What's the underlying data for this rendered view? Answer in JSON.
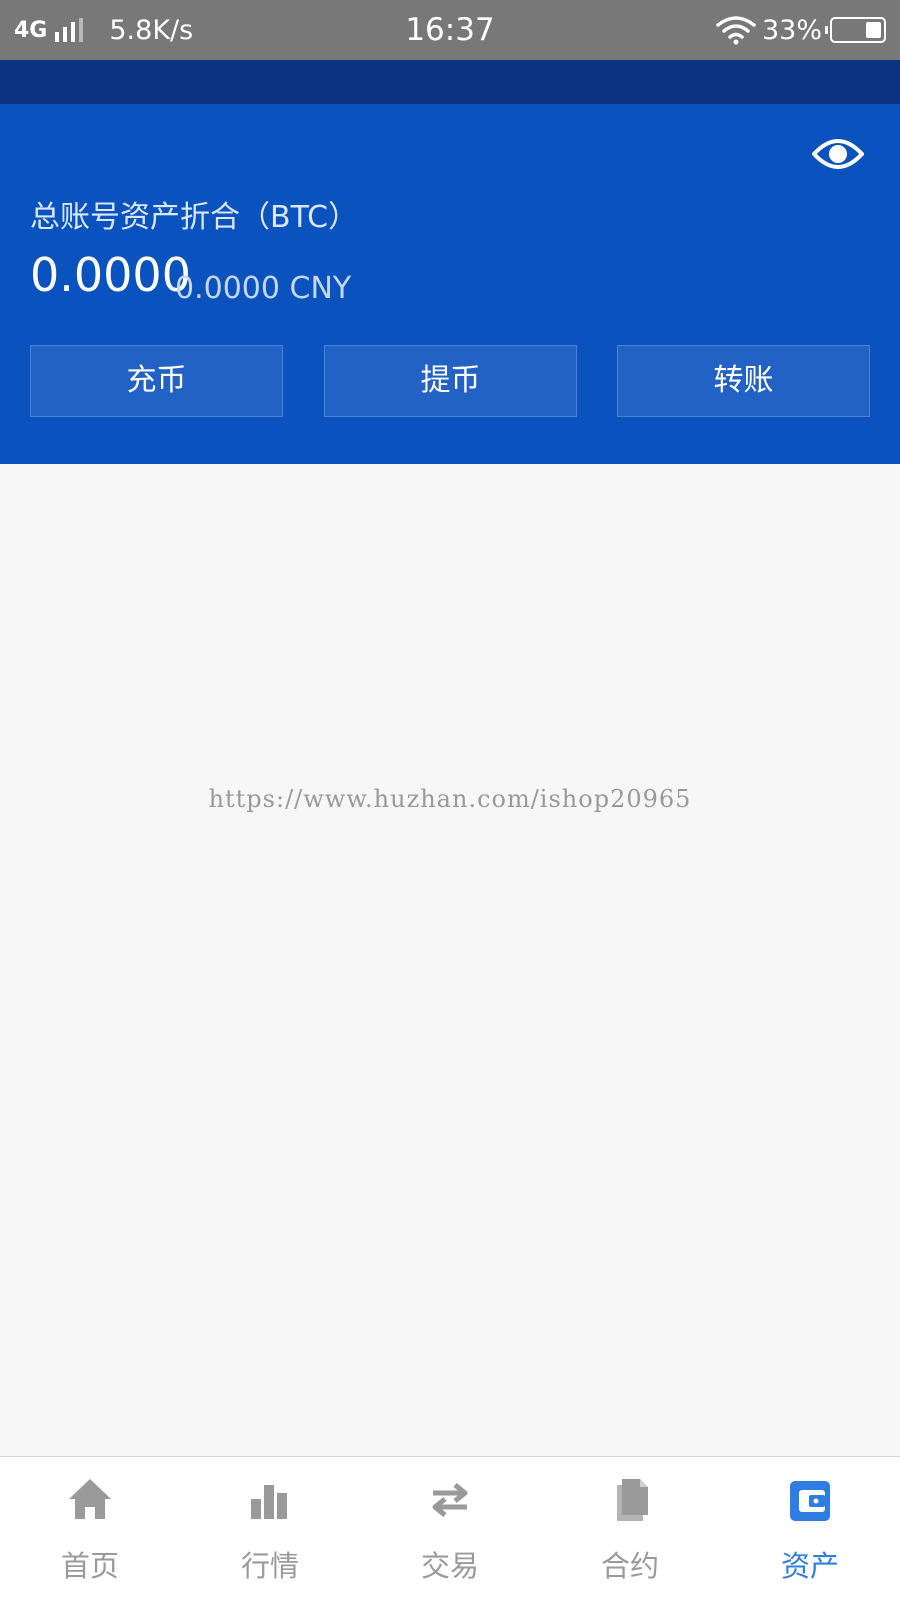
{
  "status_bar": {
    "network": "4G",
    "speed": "5.8K/s",
    "time": "16:37",
    "battery": "33%",
    "battery_level": 0.33
  },
  "assets": {
    "title": "总账号资产折合（BTC）",
    "btc_value": "0.0000",
    "cny_value": "0.0000 CNY",
    "visibility_icon": "eye-icon"
  },
  "actions": {
    "deposit": "充币",
    "withdraw": "提币",
    "transfer": "转账"
  },
  "watermark": "https://www.huzhan.com/ishop20965",
  "tabs": [
    {
      "label": "首页",
      "icon": "home-icon",
      "active": false
    },
    {
      "label": "行情",
      "icon": "bar-chart-icon",
      "active": false
    },
    {
      "label": "交易",
      "icon": "swap-arrows-icon",
      "active": false
    },
    {
      "label": "合约",
      "icon": "document-icon",
      "active": false
    },
    {
      "label": "资产",
      "icon": "wallet-icon",
      "active": true
    }
  ],
  "colors": {
    "status_bar": "#787878",
    "header": "#0a3380",
    "asset_panel": "#0a52be",
    "active_tab": "#2f7de1",
    "inactive_tab": "#9a9a9a"
  }
}
